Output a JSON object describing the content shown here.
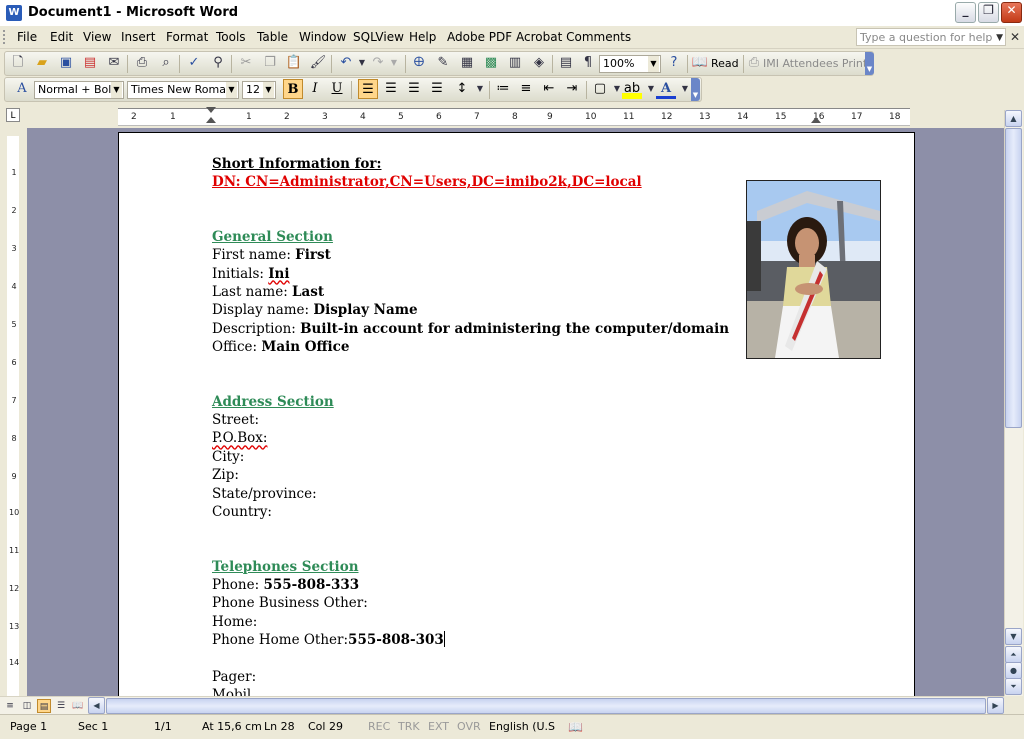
{
  "window": {
    "title": "Document1 - Microsoft Word",
    "app_icon": "word-icon",
    "controls": [
      "minimize",
      "restore",
      "close"
    ]
  },
  "menu": {
    "items": [
      "File",
      "Edit",
      "View",
      "Insert",
      "Format",
      "Tools",
      "Table",
      "Window",
      "SQLView",
      "Help",
      "Adobe PDF",
      "Acrobat Comments"
    ],
    "help_placeholder": "Type a question for help"
  },
  "standard_toolbar": {
    "zoom": "100%",
    "read_label": "Read",
    "imi_label": "IMI Attendees Print"
  },
  "formatting_toolbar": {
    "style": "Normal + Bold",
    "font": "Times New Roman",
    "size": "12",
    "bold": "B",
    "italic": "I",
    "underline": "U"
  },
  "ruler": {
    "numbers": [
      "2",
      "1",
      "1",
      "2",
      "3",
      "4",
      "5",
      "6",
      "7",
      "8",
      "9",
      "10",
      "11",
      "12",
      "13",
      "14",
      "15",
      "16",
      "17",
      "18"
    ],
    "vertical_numbers": [
      "1",
      "2",
      "3",
      "4",
      "5",
      "6",
      "7",
      "8",
      "9",
      "10",
      "11",
      "12",
      "13",
      "14"
    ]
  },
  "document": {
    "heading": "Short Information for:",
    "dn": "DN:  CN=Administrator,CN=Users,DC=imibo2k,DC=local",
    "general": {
      "title": "General Section",
      "first_name_label": "First name: ",
      "first_name": "First",
      "initials_label": "Initials: ",
      "initials": "Ini",
      "last_name_label": "Last name: ",
      "last_name": "Last",
      "display_name_label": "Display name: ",
      "display_name": "Display Name",
      "description_label": "Description: ",
      "description": "Built-in account for administering the computer/domain",
      "office_label": "Office: ",
      "office": "Main Office"
    },
    "address": {
      "title": "Address Section",
      "street": "Street:",
      "pobox": "P.O.Box:",
      "city": "City:",
      "zip": "Zip:",
      "state": "State/province:",
      "country": "Country:"
    },
    "telephones": {
      "title": "Telephones Section",
      "phone_label": "Phone: ",
      "phone": "555-808-333",
      "phone_business_other": "Phone Business Other:",
      "home": "Home:",
      "phone_home_other_label": "Phone Home Other:",
      "phone_home_other": "555-808-303",
      "pager": "Pager:",
      "mobile_partial": "Mobil"
    }
  },
  "statusbar": {
    "page": "Page  1",
    "sec": "Sec  1",
    "pages": "1/1",
    "at": "At  15,6 cm",
    "ln": "Ln  28",
    "col": "Col  29",
    "rec": "REC",
    "trk": "TRK",
    "ext": "EXT",
    "ovr": "OVR",
    "lang": "English (U.S"
  }
}
